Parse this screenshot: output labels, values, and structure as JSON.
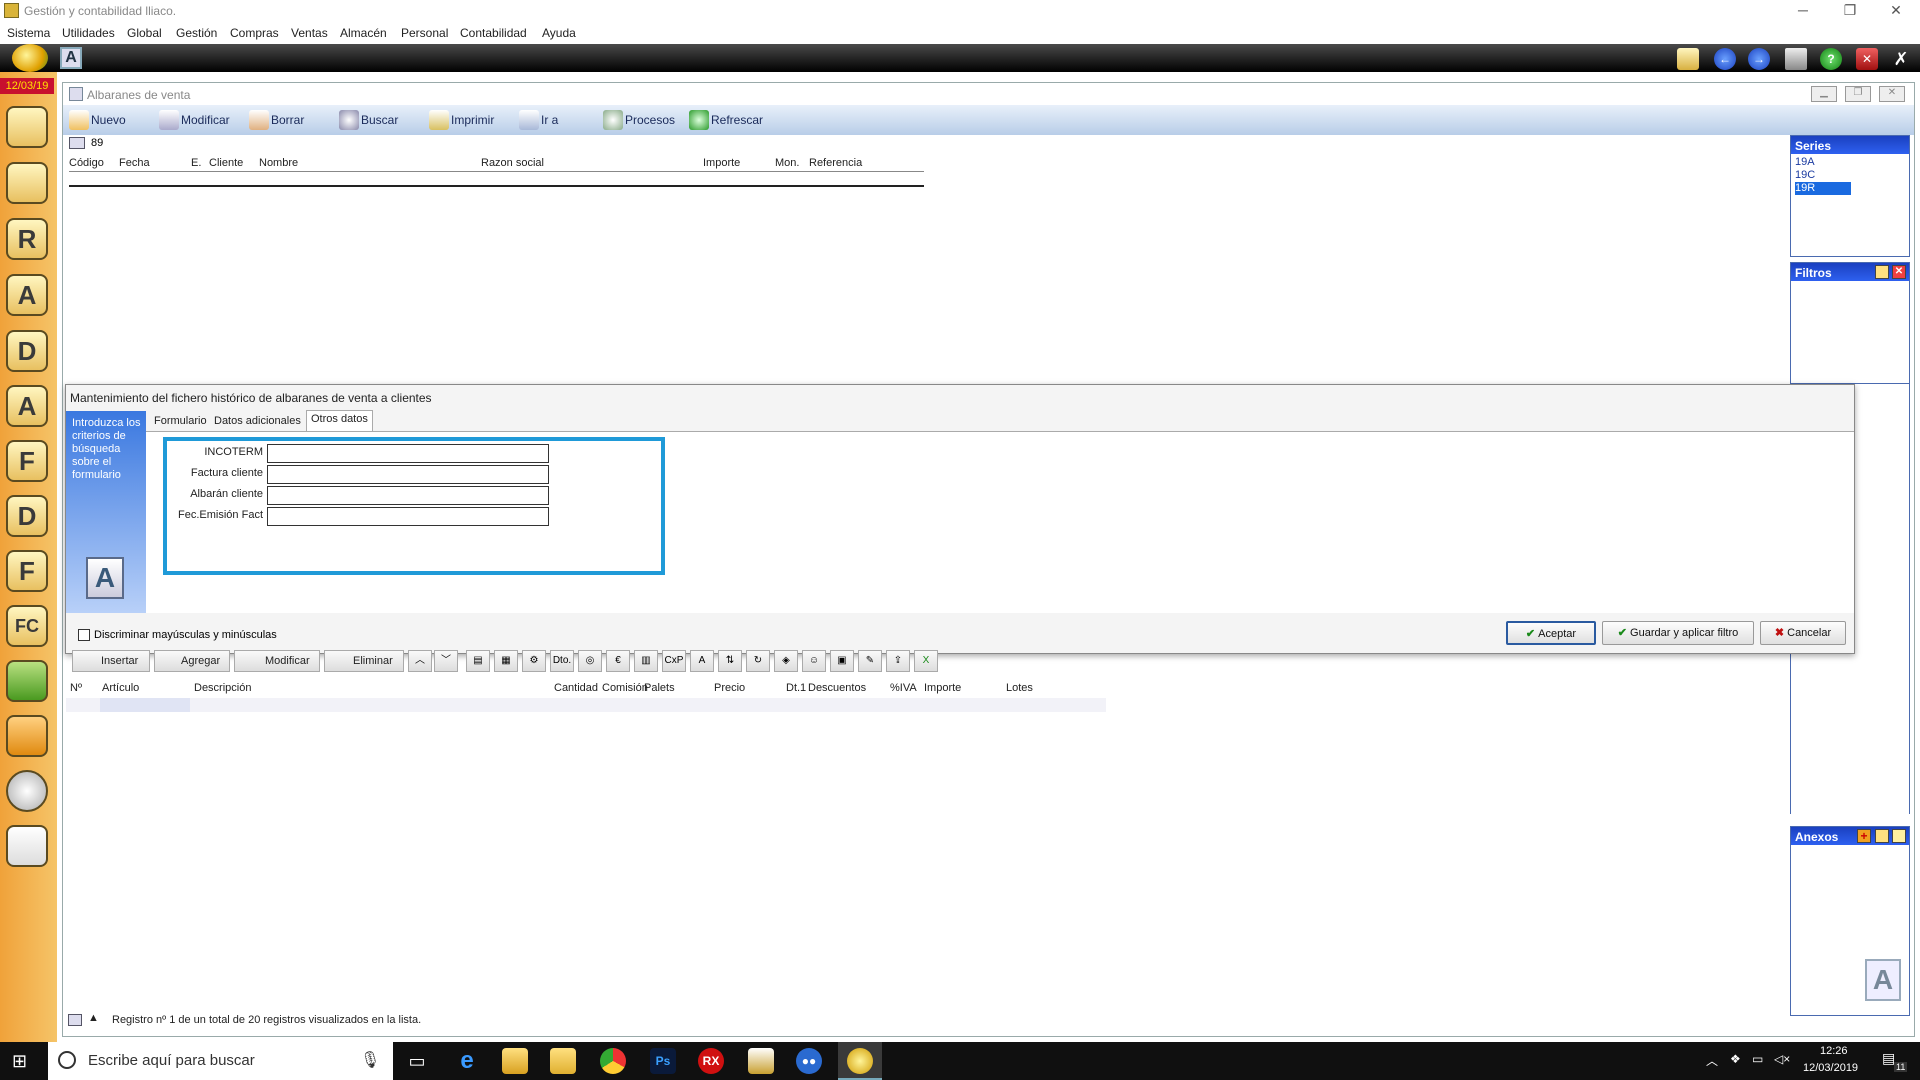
{
  "window": {
    "title": "Gestión y contabilidad lliaco.",
    "minimize": "─",
    "restore": "❐",
    "close": "✕"
  },
  "menu": [
    "Sistema",
    "Utilidades",
    "Global",
    "Gestión",
    "Compras",
    "Ventas",
    "Almacén",
    "Personal",
    "Contabilidad",
    "Ayuda"
  ],
  "sidebar": {
    "date": "12/03/19",
    "icons": [
      "users-icon",
      "user-icon",
      "user-r-icon",
      "user-a-icon",
      "letter-d-icon",
      "letter-a-icon",
      "letter-f-icon",
      "letter-d2-icon",
      "letter-f2-icon",
      "letter-fc-icon",
      "box-green-icon",
      "box-orange-icon",
      "disc-icon",
      "mail-icon"
    ],
    "letters": [
      "",
      "",
      "R",
      "A",
      "D",
      "A",
      "F",
      "D",
      "F",
      "FC",
      "",
      "",
      "",
      ""
    ]
  },
  "main_window": {
    "title": "Albaranes de venta",
    "toolbar": [
      "Nuevo",
      "Modificar",
      "Borrar",
      "Buscar",
      "Imprimir",
      "Ir a",
      "Procesos",
      "Refrescar"
    ],
    "record_count": "89",
    "columns": [
      "Código",
      "Fecha",
      "E.",
      "Cliente",
      "Nombre",
      "Razon social",
      "Importe",
      "Mon.",
      "Referencia"
    ]
  },
  "series": {
    "title": "Series",
    "items": [
      "19A",
      "19C",
      "19R"
    ],
    "selected": "19R"
  },
  "filtros": {
    "title": "Filtros"
  },
  "anexos": {
    "title": "Anexos"
  },
  "dialog": {
    "title": "Mantenimiento del fichero histórico de albaranes de venta a clientes",
    "hint": "Introduzca los criterios de búsqueda sobre el formulario",
    "tabs": [
      "Formulario",
      "Datos adicionales",
      "Otros datos"
    ],
    "active_tab": "Otros datos",
    "fields": [
      {
        "label": "INCOTERM",
        "value": ""
      },
      {
        "label": "Factura cliente",
        "value": ""
      },
      {
        "label": "Albarán cliente",
        "value": ""
      },
      {
        "label": "Fec.Emisión Fact",
        "value": ""
      }
    ],
    "checkbox_label": "Discriminar mayúsculas y minúsculas",
    "accept": "Aceptar",
    "save_apply": "Guardar y aplicar filtro",
    "cancel": "Cancelar"
  },
  "detail": {
    "buttons": [
      "Insertar",
      "Agregar",
      "Modificar",
      "Eliminar"
    ],
    "icon_buttons": [
      "Dto.",
      "CxP"
    ],
    "columns": [
      "Nº",
      "Artículo",
      "Descripción",
      "Cantidad",
      "Comisión",
      "Palets",
      "Precio",
      "Dt.1",
      "Descuentos",
      "%IVA",
      "Importe",
      "Lotes"
    ]
  },
  "status": "Registro nº 1 de un total de 20 registros visualizados en la lista.",
  "taskbar": {
    "search_placeholder": "Escribe aquí para buscar",
    "time": "12:26",
    "date": "12/03/2019",
    "notification_count": "11"
  }
}
